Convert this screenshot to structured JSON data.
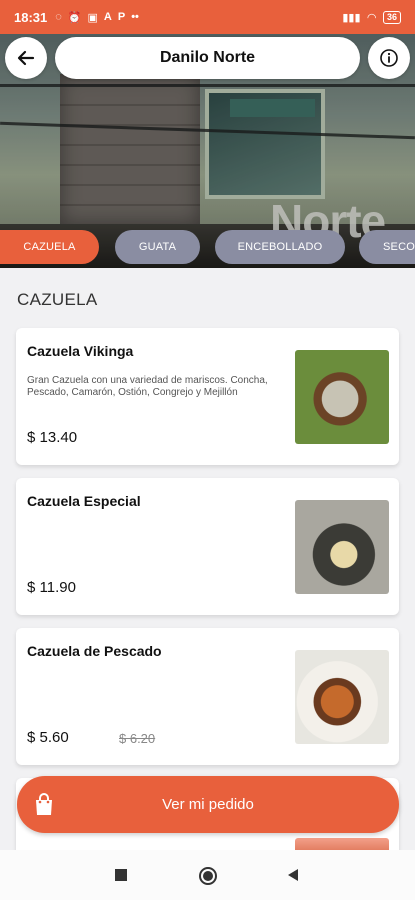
{
  "status_bar": {
    "time": "18:31",
    "notification_icons": [
      "whatsapp-icon",
      "alarm-icon",
      "app-icon",
      "a-icon",
      "parking-icon",
      "more-icon"
    ],
    "battery": "36"
  },
  "header": {
    "title": "Danilo Norte",
    "back_icon": "arrow-left-icon",
    "info_icon": "info-icon",
    "storefront_sign": "Norte"
  },
  "tabs": [
    {
      "label": "CAZUELA",
      "active": true
    },
    {
      "label": "GUATA",
      "active": false
    },
    {
      "label": "ENCEBOLLADO",
      "active": false
    },
    {
      "label": "SECOS",
      "active": false
    }
  ],
  "section": {
    "title": "CAZUELA"
  },
  "items": [
    {
      "name": "Cazuela Vikinga",
      "description": "Gran Cazuela con una variedad de mariscos. Concha, Pescado, Camarón, Ostión, Congrejo y Mejillón",
      "price": "$ 13.40",
      "old_price": ""
    },
    {
      "name": "Cazuela Especial",
      "description": "",
      "price": "$ 11.90",
      "old_price": ""
    },
    {
      "name": "Cazuela de Pescado",
      "description": "",
      "price": "$ 5.60",
      "old_price": "$ 6.20"
    }
  ],
  "order_button": {
    "label": "Ver mi pedido",
    "icon": "shopping-bag-icon"
  },
  "colors": {
    "accent": "#e8603c",
    "tab_inactive": "#8a8da2"
  }
}
